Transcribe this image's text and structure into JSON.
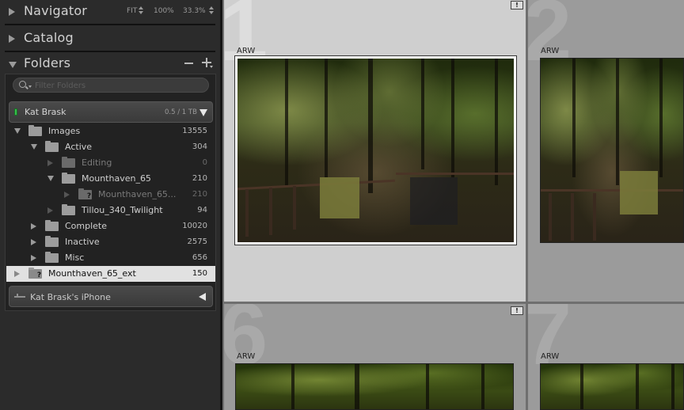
{
  "navigator": {
    "title": "Navigator",
    "zoom_options": [
      "FIT",
      "100%",
      "33.3%"
    ]
  },
  "catalog": {
    "title": "Catalog"
  },
  "folders": {
    "title": "Folders",
    "filter_placeholder": "Filter Folders",
    "volume": {
      "name": "Kat Brask",
      "usage": "0.5 / 1 TB",
      "status_color": "#35c04a"
    },
    "tree": [
      {
        "name": "Images",
        "count": "13555",
        "state": "expanded"
      },
      {
        "name": "Active",
        "count": "304",
        "state": "expanded"
      },
      {
        "name": "Editing",
        "count": "0",
        "state": "empty"
      },
      {
        "name": "Mounthaven_65",
        "count": "210",
        "state": "expanded"
      },
      {
        "name": "Mounthaven_65...",
        "count": "210",
        "state": "missing"
      },
      {
        "name": "Tillou_340_Twilight",
        "count": "94",
        "state": "collapsed"
      },
      {
        "name": "Complete",
        "count": "10020",
        "state": "collapsed"
      },
      {
        "name": "Inactive",
        "count": "2575",
        "state": "collapsed"
      },
      {
        "name": "Misc",
        "count": "656",
        "state": "collapsed"
      },
      {
        "name": "Mounthaven_65_ext",
        "count": "150",
        "state": "selected-missing"
      }
    ],
    "device": {
      "name": "Kat Brask's iPhone"
    }
  },
  "grid": {
    "cells": [
      {
        "index": "1",
        "ext": "ARW",
        "badge": "!",
        "selected": true
      },
      {
        "index": "2",
        "ext": "ARW",
        "badge": "",
        "selected": false
      },
      {
        "index": "6",
        "ext": "ARW",
        "badge": "!",
        "selected": false
      },
      {
        "index": "7",
        "ext": "ARW",
        "badge": "",
        "selected": false
      }
    ]
  },
  "colors": {
    "panel_bg": "#2b2b2b",
    "selected_row": "#e1e1e1",
    "selected_cell": "#cfcfcf",
    "cell_bg": "#9b9b9b"
  }
}
